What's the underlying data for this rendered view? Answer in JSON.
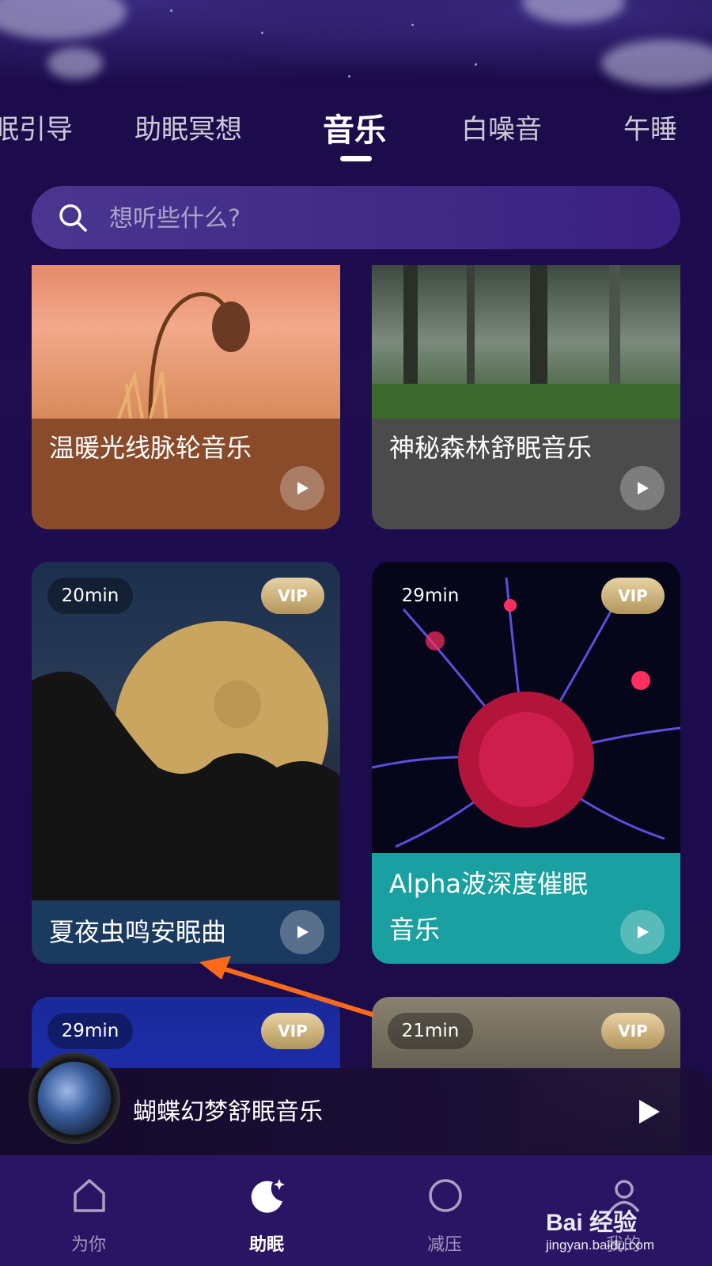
{
  "tabs": [
    {
      "label": "眠引导",
      "active": false
    },
    {
      "label": "助眠冥想",
      "active": false
    },
    {
      "label": "音乐",
      "active": true
    },
    {
      "label": "白噪音",
      "active": false
    },
    {
      "label": "午睡",
      "active": false
    }
  ],
  "search": {
    "placeholder": "想听些什么?"
  },
  "cards": [
    {
      "title": "温暖光线脉轮音乐",
      "caption_color": "#8a4b2b",
      "image": "flower-at-sunset",
      "duration": "",
      "vip": false
    },
    {
      "title": "神秘森林舒眠音乐",
      "caption_color": "#4b4b4b",
      "image": "misty-forest",
      "duration": "",
      "vip": false
    },
    {
      "title": "夏夜虫鸣安眠曲",
      "caption_color": "#1a3a60",
      "image": "full-moon-behind-trees",
      "duration": "20min",
      "vip": true,
      "vip_label": "VIP"
    },
    {
      "title": "Alpha波深度催眠音乐",
      "caption_color": "#1aa0a0",
      "image": "plasma-ball",
      "duration": "29min",
      "vip": true,
      "vip_label": "VIP"
    },
    {
      "title": "",
      "image": "blue-gradient",
      "duration": "29min",
      "vip": true,
      "vip_label": "VIP"
    },
    {
      "title": "",
      "image": "face-with-coffee",
      "duration": "21min",
      "vip": true,
      "vip_label": "VIP"
    }
  ],
  "player": {
    "title": "蝴蝶幻梦舒眠音乐",
    "state_icon": "play-icon"
  },
  "nav": [
    {
      "label": "为你",
      "icon": "home-icon",
      "active": false
    },
    {
      "label": "助眠",
      "icon": "moon-icon",
      "active": true
    },
    {
      "label": "减压",
      "icon": "circle-icon",
      "active": false
    },
    {
      "label": "我的",
      "icon": "profile-icon",
      "active": false
    }
  ],
  "watermark": {
    "logo": "Bai 经验",
    "sub": "jingyan.baidu.com"
  },
  "colors": {
    "background": "#1c0c48",
    "accent": "#ffffff",
    "vip_gold": "#c9ad74",
    "teal": "#1aa0a0"
  }
}
